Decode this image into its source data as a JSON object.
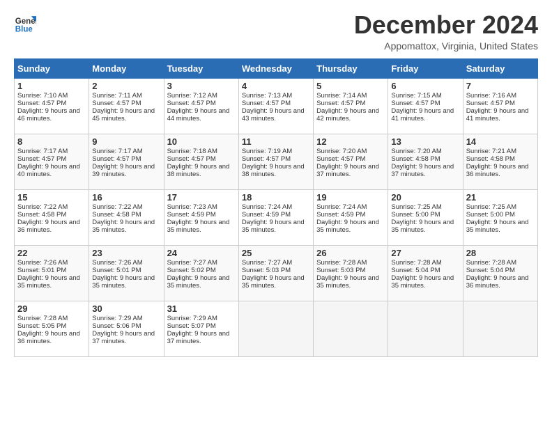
{
  "logo": {
    "line1": "General",
    "line2": "Blue"
  },
  "title": "December 2024",
  "location": "Appomattox, Virginia, United States",
  "days_of_week": [
    "Sunday",
    "Monday",
    "Tuesday",
    "Wednesday",
    "Thursday",
    "Friday",
    "Saturday"
  ],
  "weeks": [
    [
      {
        "day": 1,
        "sunrise": "7:10 AM",
        "sunset": "4:57 PM",
        "daylight": "9 hours and 46 minutes."
      },
      {
        "day": 2,
        "sunrise": "7:11 AM",
        "sunset": "4:57 PM",
        "daylight": "9 hours and 45 minutes."
      },
      {
        "day": 3,
        "sunrise": "7:12 AM",
        "sunset": "4:57 PM",
        "daylight": "9 hours and 44 minutes."
      },
      {
        "day": 4,
        "sunrise": "7:13 AM",
        "sunset": "4:57 PM",
        "daylight": "9 hours and 43 minutes."
      },
      {
        "day": 5,
        "sunrise": "7:14 AM",
        "sunset": "4:57 PM",
        "daylight": "9 hours and 42 minutes."
      },
      {
        "day": 6,
        "sunrise": "7:15 AM",
        "sunset": "4:57 PM",
        "daylight": "9 hours and 41 minutes."
      },
      {
        "day": 7,
        "sunrise": "7:16 AM",
        "sunset": "4:57 PM",
        "daylight": "9 hours and 41 minutes."
      }
    ],
    [
      {
        "day": 8,
        "sunrise": "7:17 AM",
        "sunset": "4:57 PM",
        "daylight": "9 hours and 40 minutes."
      },
      {
        "day": 9,
        "sunrise": "7:17 AM",
        "sunset": "4:57 PM",
        "daylight": "9 hours and 39 minutes."
      },
      {
        "day": 10,
        "sunrise": "7:18 AM",
        "sunset": "4:57 PM",
        "daylight": "9 hours and 38 minutes."
      },
      {
        "day": 11,
        "sunrise": "7:19 AM",
        "sunset": "4:57 PM",
        "daylight": "9 hours and 38 minutes."
      },
      {
        "day": 12,
        "sunrise": "7:20 AM",
        "sunset": "4:57 PM",
        "daylight": "9 hours and 37 minutes."
      },
      {
        "day": 13,
        "sunrise": "7:20 AM",
        "sunset": "4:58 PM",
        "daylight": "9 hours and 37 minutes."
      },
      {
        "day": 14,
        "sunrise": "7:21 AM",
        "sunset": "4:58 PM",
        "daylight": "9 hours and 36 minutes."
      }
    ],
    [
      {
        "day": 15,
        "sunrise": "7:22 AM",
        "sunset": "4:58 PM",
        "daylight": "9 hours and 36 minutes."
      },
      {
        "day": 16,
        "sunrise": "7:22 AM",
        "sunset": "4:58 PM",
        "daylight": "9 hours and 35 minutes."
      },
      {
        "day": 17,
        "sunrise": "7:23 AM",
        "sunset": "4:59 PM",
        "daylight": "9 hours and 35 minutes."
      },
      {
        "day": 18,
        "sunrise": "7:24 AM",
        "sunset": "4:59 PM",
        "daylight": "9 hours and 35 minutes."
      },
      {
        "day": 19,
        "sunrise": "7:24 AM",
        "sunset": "4:59 PM",
        "daylight": "9 hours and 35 minutes."
      },
      {
        "day": 20,
        "sunrise": "7:25 AM",
        "sunset": "5:00 PM",
        "daylight": "9 hours and 35 minutes."
      },
      {
        "day": 21,
        "sunrise": "7:25 AM",
        "sunset": "5:00 PM",
        "daylight": "9 hours and 35 minutes."
      }
    ],
    [
      {
        "day": 22,
        "sunrise": "7:26 AM",
        "sunset": "5:01 PM",
        "daylight": "9 hours and 35 minutes."
      },
      {
        "day": 23,
        "sunrise": "7:26 AM",
        "sunset": "5:01 PM",
        "daylight": "9 hours and 35 minutes."
      },
      {
        "day": 24,
        "sunrise": "7:27 AM",
        "sunset": "5:02 PM",
        "daylight": "9 hours and 35 minutes."
      },
      {
        "day": 25,
        "sunrise": "7:27 AM",
        "sunset": "5:03 PM",
        "daylight": "9 hours and 35 minutes."
      },
      {
        "day": 26,
        "sunrise": "7:28 AM",
        "sunset": "5:03 PM",
        "daylight": "9 hours and 35 minutes."
      },
      {
        "day": 27,
        "sunrise": "7:28 AM",
        "sunset": "5:04 PM",
        "daylight": "9 hours and 35 minutes."
      },
      {
        "day": 28,
        "sunrise": "7:28 AM",
        "sunset": "5:04 PM",
        "daylight": "9 hours and 36 minutes."
      }
    ],
    [
      {
        "day": 29,
        "sunrise": "7:28 AM",
        "sunset": "5:05 PM",
        "daylight": "9 hours and 36 minutes."
      },
      {
        "day": 30,
        "sunrise": "7:29 AM",
        "sunset": "5:06 PM",
        "daylight": "9 hours and 37 minutes."
      },
      {
        "day": 31,
        "sunrise": "7:29 AM",
        "sunset": "5:07 PM",
        "daylight": "9 hours and 37 minutes."
      },
      null,
      null,
      null,
      null
    ]
  ]
}
